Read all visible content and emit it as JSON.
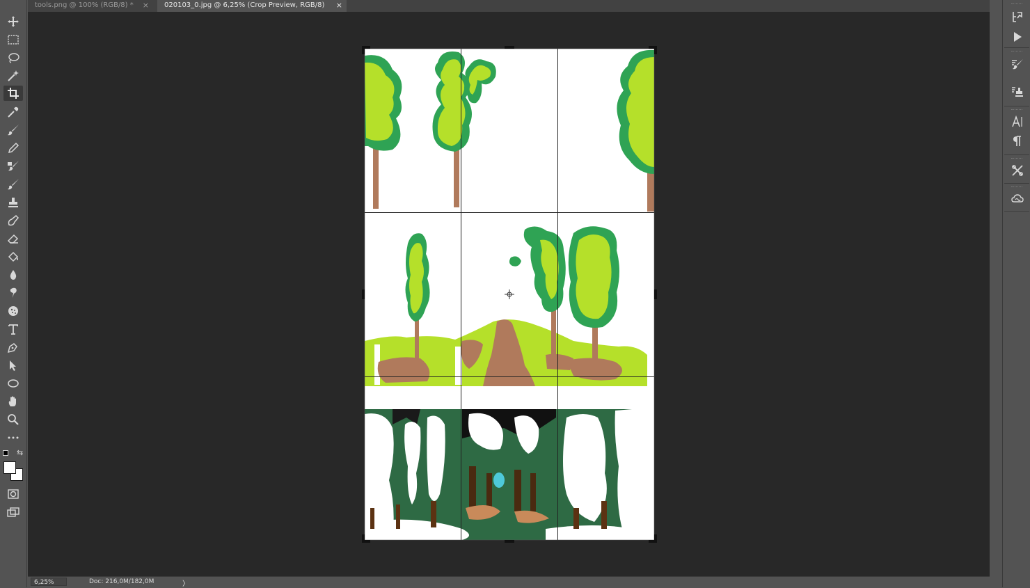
{
  "tabs": [
    {
      "label": "tools.png @ 100% (RGB/8) *",
      "close": "×",
      "active": false
    },
    {
      "label": "020103_0.jpg @ 6,25% (Crop Preview, RGB/8)",
      "close": "×",
      "active": true
    }
  ],
  "tools": [
    {
      "name": "move-tool",
      "icon": "move-icon"
    },
    {
      "name": "marquee-tool",
      "icon": "rect-marquee-icon"
    },
    {
      "name": "lasso-tool",
      "icon": "lasso-icon"
    },
    {
      "name": "magic-wand-tool",
      "icon": "magic-wand-icon"
    },
    {
      "name": "crop-tool",
      "icon": "crop-icon",
      "active": true
    },
    {
      "name": "eyedropper-tool",
      "icon": "eyedropper-icon"
    },
    {
      "name": "brush-tool",
      "icon": "brush-icon"
    },
    {
      "name": "pencil-tool",
      "icon": "pencil-icon"
    },
    {
      "name": "mixer-brush-tool",
      "icon": "mixer-brush-icon"
    },
    {
      "name": "history-brush-tool",
      "icon": "history-brush-icon"
    },
    {
      "name": "stamp-tool",
      "icon": "stamp-icon"
    },
    {
      "name": "healing-brush-tool",
      "icon": "healing-icon"
    },
    {
      "name": "eraser-tool",
      "icon": "eraser-icon"
    },
    {
      "name": "paint-bucket-tool",
      "icon": "bucket-icon"
    },
    {
      "name": "blur-tool",
      "icon": "drop-icon"
    },
    {
      "name": "smudge-tool",
      "icon": "smudge-icon"
    },
    {
      "name": "sponge-tool",
      "icon": "sponge-icon"
    },
    {
      "name": "type-tool",
      "icon": "type-icon"
    },
    {
      "name": "pen-tool",
      "icon": "pen-icon"
    },
    {
      "name": "path-selection-tool",
      "icon": "arrow-icon"
    },
    {
      "name": "ellipse-tool",
      "icon": "ellipse-icon"
    },
    {
      "name": "hand-tool",
      "icon": "hand-icon"
    },
    {
      "name": "zoom-tool",
      "icon": "zoom-icon"
    },
    {
      "name": "more-tools",
      "icon": "ellipsis-icon"
    }
  ],
  "colors": {
    "foreground": "#ffffff",
    "background": "#ffffff",
    "canvas_bg": "#282828",
    "ui_bg": "#535353"
  },
  "status": {
    "zoom": "6,25%",
    "doc": "Doc: 216,0M/182,0M",
    "arrow": "〉"
  },
  "right_panel": [
    {
      "name": "history-panel-button",
      "icon": "history-icon"
    },
    {
      "name": "actions-panel-button",
      "icon": "play-icon"
    },
    {
      "name": "brushes-panel-button",
      "icon": "brush-settings-icon"
    },
    {
      "name": "clone-source-panel-button",
      "icon": "clone-source-icon"
    },
    {
      "name": "character-panel-button",
      "icon": "character-icon"
    },
    {
      "name": "paragraph-panel-button",
      "icon": "paragraph-icon"
    },
    {
      "name": "tool-presets-panel-button",
      "icon": "tools-icon"
    },
    {
      "name": "libraries-panel-button",
      "icon": "creative-cloud-icon"
    }
  ]
}
